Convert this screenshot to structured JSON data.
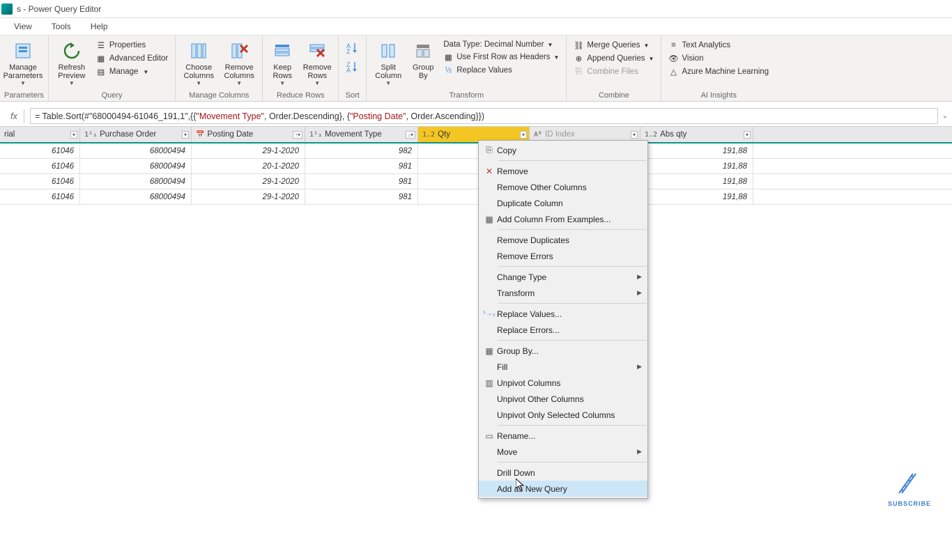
{
  "titlebar": {
    "text": "s - Power Query Editor"
  },
  "menubar": {
    "view": "View",
    "tools": "Tools",
    "help": "Help"
  },
  "ribbon": {
    "parameters": {
      "manage_parameters": "Manage\nParameters",
      "group": "Parameters"
    },
    "query": {
      "refresh_preview": "Refresh\nPreview",
      "properties": "Properties",
      "advanced_editor": "Advanced Editor",
      "manage": "Manage",
      "group": "Query"
    },
    "manage_columns": {
      "choose_columns": "Choose\nColumns",
      "remove_columns": "Remove\nColumns",
      "group": "Manage Columns"
    },
    "reduce_rows": {
      "keep_rows": "Keep\nRows",
      "remove_rows": "Remove\nRows",
      "group": "Reduce Rows"
    },
    "sort": {
      "group": "Sort"
    },
    "transform": {
      "split_column": "Split\nColumn",
      "group_by": "Group\nBy",
      "data_type": "Data Type: Decimal Number",
      "first_row_headers": "Use First Row as Headers",
      "replace_values": "Replace Values",
      "group": "Transform"
    },
    "combine": {
      "merge_queries": "Merge Queries",
      "append_queries": "Append Queries",
      "combine_files": "Combine Files",
      "group": "Combine"
    },
    "ai": {
      "text_analytics": "Text Analytics",
      "vision": "Vision",
      "azure_ml": "Azure Machine Learning",
      "group": "AI Insights"
    }
  },
  "formula": {
    "prefix": "= Table.Sort(#\"68000494-61046_191,1\",{{",
    "str1": "\"Movement Type\"",
    "mid1": ", Order.Descending}, {",
    "str2": "\"Posting Date\"",
    "suffix": ", Order.Ascending}})"
  },
  "columns": {
    "c0": "rial",
    "c1": "Purchase Order",
    "c2": "Posting Date",
    "c3": "Movement Type",
    "c4": "Qty",
    "c5": "ID Index",
    "c6": "Abs qty"
  },
  "rows": [
    {
      "c0": "61046",
      "c1": "68000494",
      "c2": "29-1-2020",
      "c3": "982",
      "c6": "191,88"
    },
    {
      "c0": "61046",
      "c1": "68000494",
      "c2": "20-1-2020",
      "c3": "981",
      "c6": "191,88"
    },
    {
      "c0": "61046",
      "c1": "68000494",
      "c2": "29-1-2020",
      "c3": "981",
      "c6": "191,88"
    },
    {
      "c0": "61046",
      "c1": "68000494",
      "c2": "29-1-2020",
      "c3": "981",
      "c6": "191,88"
    }
  ],
  "context_menu": {
    "copy": "Copy",
    "remove": "Remove",
    "remove_other": "Remove Other Columns",
    "duplicate": "Duplicate Column",
    "add_from_examples": "Add Column From Examples...",
    "remove_duplicates": "Remove Duplicates",
    "remove_errors": "Remove Errors",
    "change_type": "Change Type",
    "transform": "Transform",
    "replace_values": "Replace Values...",
    "replace_errors": "Replace Errors...",
    "group_by": "Group By...",
    "fill": "Fill",
    "unpivot_columns": "Unpivot Columns",
    "unpivot_other": "Unpivot Other Columns",
    "unpivot_selected": "Unpivot Only Selected Columns",
    "rename": "Rename...",
    "move": "Move",
    "drill_down": "Drill Down",
    "add_as_new_query": "Add as New Query"
  },
  "subscribe": "SUBSCRIBE"
}
